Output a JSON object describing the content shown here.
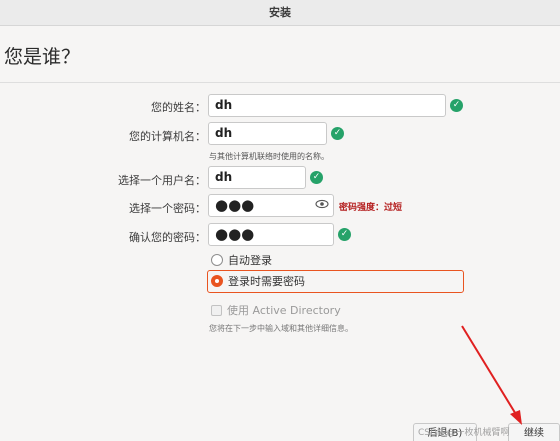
{
  "window": {
    "title": "安装"
  },
  "page": {
    "heading": "您是谁？"
  },
  "form": {
    "name": {
      "label": "您的姓名：",
      "value": "dh"
    },
    "computer": {
      "label": "您的计算机名：",
      "value": "dh",
      "hint": "与其他计算机联络时使用的名称。"
    },
    "username": {
      "label": "选择一个用户名：",
      "value": "dh"
    },
    "password": {
      "label": "选择一个密码：",
      "value": "●●●",
      "strength": "密码强度：过短"
    },
    "confirm": {
      "label": "确认您的密码：",
      "value": "●●●"
    },
    "auto_login": {
      "label": "自动登录",
      "selected": false
    },
    "require_password": {
      "label": "登录时需要密码",
      "selected": true
    },
    "active_directory": {
      "label": "使用 Active Directory",
      "checked": false,
      "enabled": false,
      "hint": "您将在下一步中输入域和其他详细信息。"
    }
  },
  "footer": {
    "back_label": "后退(B)",
    "continue_label": "继续",
    "watermark": "CSDN @一枚机械臂啊"
  },
  "colors": {
    "accent": "#e95420",
    "ok": "#26a269",
    "warning": "#b41d1d"
  },
  "icons": {
    "ok": "check-circle-icon",
    "eye": "eye-icon"
  }
}
